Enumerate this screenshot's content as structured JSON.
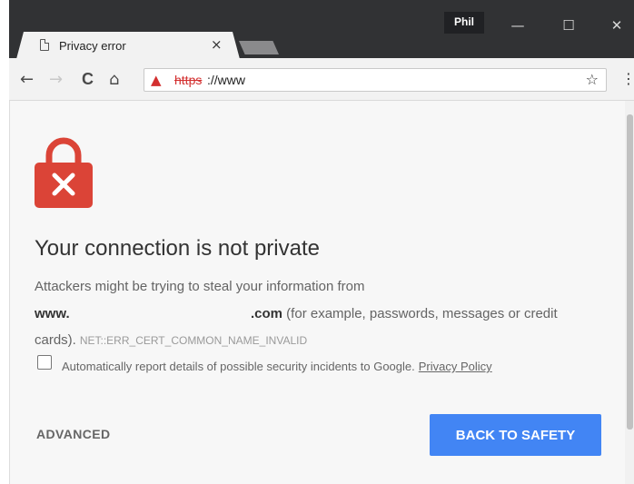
{
  "window": {
    "profile_name": "Phil",
    "minimize_glyph": "—",
    "maximize_glyph": "☐",
    "close_glyph": "✕"
  },
  "tab": {
    "title": "Privacy error",
    "close_glyph": "×",
    "icon": "page-icon"
  },
  "toolbar": {
    "back_glyph": "←",
    "forward_glyph": "→",
    "reload_glyph": "C",
    "home_glyph": "⌂",
    "url_scheme": "https",
    "url_rest": "://www",
    "warning_glyph": "▲",
    "star_glyph": "☆",
    "menu_glyph": "⋮"
  },
  "page": {
    "heading": "Your connection is not private",
    "line1": "Attackers might be trying to steal your information from",
    "domain_start": "www.",
    "domain_end": ".com",
    "line2_rest": " (for example, passwords, messages or credit",
    "line3": "cards).",
    "error_code": "NET::ERR_CERT_COMMON_NAME_INVALID",
    "checkbox_label": "Automatically report details of possible security incidents to Google.",
    "privacy_link": "Privacy Policy",
    "advanced_label": "ADVANCED",
    "back_label": "BACK TO SAFETY"
  },
  "colors": {
    "accent_blue": "#4285f4",
    "lock_red": "#db4437",
    "warning_red": "#d32f2f"
  }
}
